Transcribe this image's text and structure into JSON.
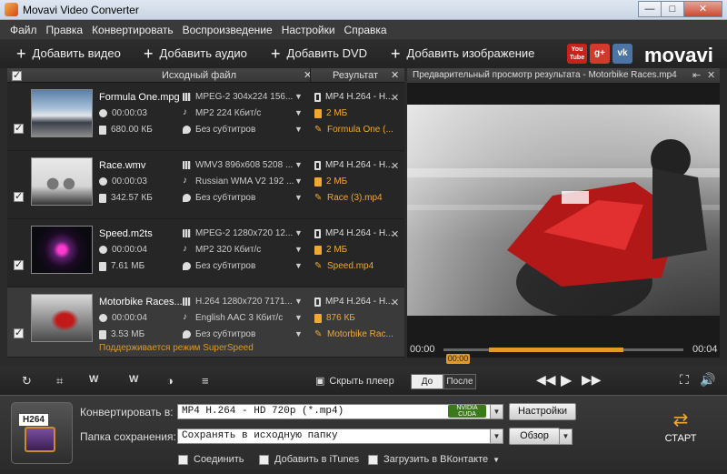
{
  "window": {
    "title": "Movavi Video Converter",
    "min": "—",
    "max": "□",
    "close": "✕"
  },
  "menu": [
    "Файл",
    "Правка",
    "Конвертировать",
    "Воспроизведение",
    "Настройки",
    "Справка"
  ],
  "toolbar": {
    "add_video": "Добавить видео",
    "add_audio": "Добавить аудио",
    "add_dvd": "Добавить DVD",
    "add_image": "Добавить изображение",
    "logo": "movavi",
    "youtube": "You Tube",
    "gplus": "g+",
    "vk": "vk"
  },
  "filelist": {
    "col_source": "Исходный файл",
    "col_result": "Результат",
    "superspeed": "Поддерживается режим SuperSpeed",
    "rows": [
      {
        "name": "Formula One.mpg",
        "video": "MPEG-2 304x224 156...",
        "duration": "00:00:03",
        "audio": "MP2 224 Кбит/с",
        "size": "680.00 КБ",
        "subs": "Без субтитров",
        "out_format": "MP4 H.264 - H...",
        "out_size": "2 МБ",
        "out_name": "Formula One (...",
        "checked": true,
        "selected": false
      },
      {
        "name": "Race.wmv",
        "video": "WMV3 896x608 5208 ...",
        "duration": "00:00:03",
        "audio": "Russian WMA V2 192 ...",
        "size": "342.57 КБ",
        "subs": "Без субтитров",
        "out_format": "MP4 H.264 - H...",
        "out_size": "2 МБ",
        "out_name": "Race (3).mp4",
        "checked": true,
        "selected": false
      },
      {
        "name": "Speed.m2ts",
        "video": "MPEG-2 1280x720 12...",
        "duration": "00:00:04",
        "audio": "MP2 320 Кбит/с",
        "size": "7.61 МБ",
        "subs": "Без субтитров",
        "out_format": "MP4 H.264 - H...",
        "out_size": "2 МБ",
        "out_name": "Speed.mp4",
        "checked": true,
        "selected": false
      },
      {
        "name": "Motorbike Races....",
        "video": "H.264 1280x720 7171...",
        "duration": "00:00:04",
        "audio": "English AAC 3 Кбит/с",
        "size": "3.53 МБ",
        "subs": "Без субтитров",
        "out_format": "MP4 H.264 - H...",
        "out_size": "876 КБ",
        "out_name": "Motorbike Rac...",
        "checked": true,
        "selected": true
      }
    ]
  },
  "preview": {
    "title": "Предварительный просмотр результата - Motorbike Races.mp4",
    "time_start": "00:00",
    "time_end": "00:04",
    "badge": "00:00",
    "progress_start": 0.19,
    "progress_end": 0.75
  },
  "controls": {
    "hide_player": "Скрыть плеер",
    "before": "До",
    "after": "После"
  },
  "bottom": {
    "format_badge": "H264",
    "convert_label": "Конвертировать в:",
    "convert_value": "MP4 H.264 - HD 720p (*.mp4)",
    "cuda": "NVIDIA CUDA",
    "settings_btn": "Настройки",
    "folder_label": "Папка сохранения:",
    "folder_value": "Сохранять в исходную папку",
    "browse_btn": "Обзор",
    "opt_join": "Соединить",
    "opt_itunes": "Добавить в iTunes",
    "opt_vk": "Загрузить в ВКонтакте",
    "start": "СТАРТ"
  },
  "colors": {
    "accent": "#f0a830",
    "bg": "#2b2b2b"
  }
}
